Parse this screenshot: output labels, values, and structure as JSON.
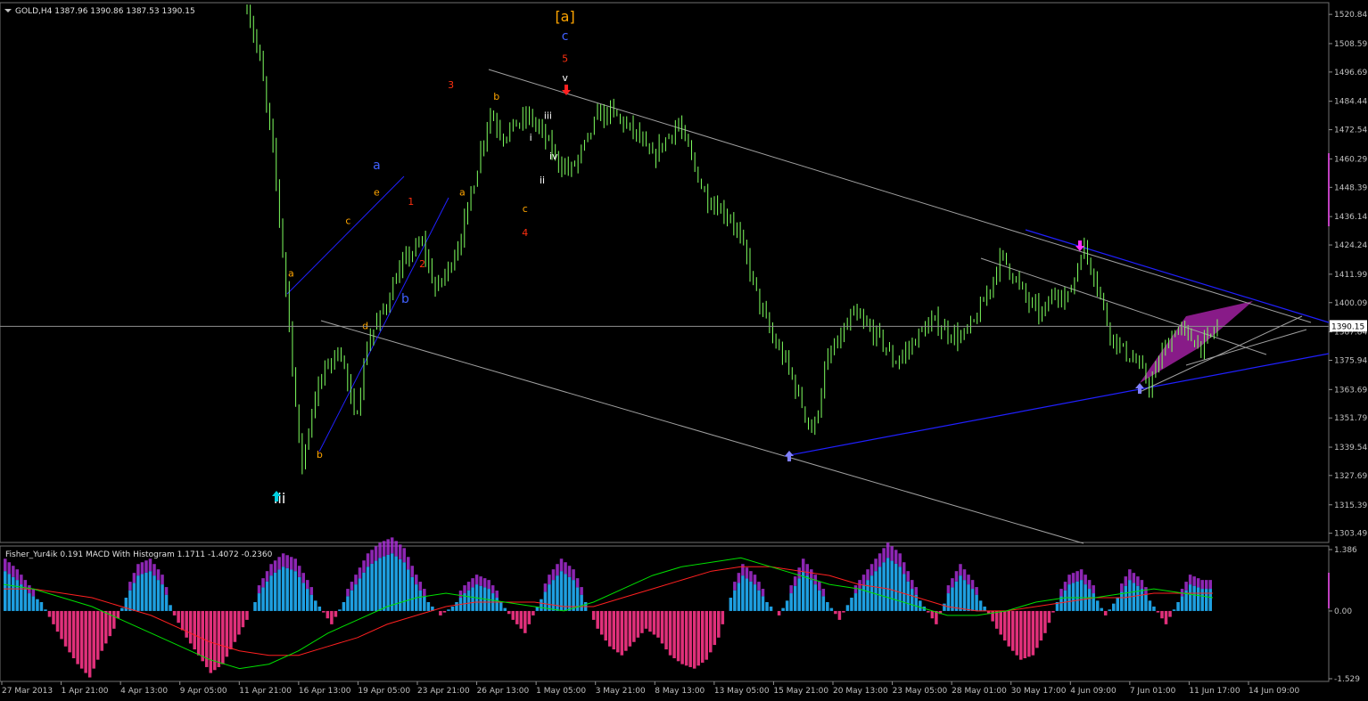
{
  "header": {
    "symbol_info": "GOLD,H4  1387.96 1390.86 1387.53 1390.15"
  },
  "indicator_header": {
    "label": "Fisher_Yur4ik 0.191  MACD With Histogram 1.1711 -1.4072 -0.2360"
  },
  "colors": {
    "background": "#000000",
    "candle": "#7fff5f",
    "axis_text": "#c0c0c0",
    "trendline_blue": "#2020ff",
    "trendline_gray": "#a0a0a0",
    "pattern_fill": "#a020a0",
    "hist_pos": "#1e9fe0",
    "hist_neg": "#e0307a",
    "fisher_pos": "#b030e0",
    "macd_green": "#00e000",
    "signal_red": "#ff2020"
  },
  "chart_data": [
    {
      "type": "candlestick",
      "symbol": "GOLD",
      "timeframe": "H4",
      "title": "GOLD,H4",
      "ohlc_last": {
        "open": 1387.96,
        "high": 1390.86,
        "low": 1387.53,
        "close": 1390.15
      },
      "current_price": "1390.15",
      "ylim": [
        1300.0,
        1525.0
      ],
      "y_ticks": [
        "1520.84",
        "1508.59",
        "1496.69",
        "1484.44",
        "1472.54",
        "1460.29",
        "1448.39",
        "1436.14",
        "1424.24",
        "1411.99",
        "1400.09",
        "1387.84",
        "1375.94",
        "1363.69",
        "1351.79",
        "1339.54",
        "1327.69",
        "1315.39",
        "1303.49"
      ],
      "x_ticks": [
        "27 Mar 2013",
        "1 Apr 21:00",
        "4 Apr 13:00",
        "9 Apr 05:00",
        "11 Apr 21:00",
        "16 Apr 13:00",
        "19 Apr 05:00",
        "23 Apr 21:00",
        "26 Apr 13:00",
        "1 May 05:00",
        "3 May 21:00",
        "8 May 13:00",
        "13 May 05:00",
        "15 May 21:00",
        "20 May 13:00",
        "23 May 05:00",
        "28 May 01:00",
        "30 May 17:00",
        "4 Jun 09:00",
        "7 Jun 01:00",
        "11 Jun 17:00",
        "14 Jun 09:00"
      ],
      "close_path": [
        1525,
        1500,
        1460,
        1400,
        1330,
        1360,
        1375,
        1380,
        1350,
        1385,
        1395,
        1410,
        1420,
        1425,
        1405,
        1415,
        1430,
        1455,
        1480,
        1470,
        1475,
        1478,
        1470,
        1460,
        1455,
        1465,
        1478,
        1480,
        1475,
        1470,
        1460,
        1468,
        1475,
        1460,
        1445,
        1440,
        1435,
        1420,
        1400,
        1385,
        1375,
        1360,
        1345,
        1375,
        1385,
        1395,
        1390,
        1385,
        1375,
        1380,
        1388,
        1392,
        1388,
        1385,
        1392,
        1405,
        1420,
        1410,
        1400,
        1395,
        1405,
        1402,
        1424,
        1410,
        1388,
        1380,
        1375,
        1365,
        1380,
        1390,
        1385,
        1382,
        1390
      ],
      "wave_labels": [
        {
          "text": "[a]",
          "color": "#ffa500",
          "x": 99,
          "y": 1518
        },
        {
          "text": "c",
          "color": "#4060ff",
          "x": 99,
          "y": 1510
        },
        {
          "text": "5",
          "color": "#ff3010",
          "x": 99,
          "y": 1501
        },
        {
          "text": "v",
          "color": "#ffffff",
          "x": 99,
          "y": 1493
        },
        {
          "text": "3",
          "color": "#ff3010",
          "x": 79,
          "y": 1490
        },
        {
          "text": "b",
          "color": "#ffa500",
          "x": 87,
          "y": 1485
        },
        {
          "text": "iii",
          "color": "#ffffff",
          "x": 96,
          "y": 1477
        },
        {
          "text": "i",
          "color": "#ffffff",
          "x": 93,
          "y": 1468
        },
        {
          "text": "iv",
          "color": "#ffffff",
          "x": 97,
          "y": 1460
        },
        {
          "text": "ii",
          "color": "#ffffff",
          "x": 95,
          "y": 1450
        },
        {
          "text": "a",
          "color": "#ffa500",
          "x": 81,
          "y": 1445
        },
        {
          "text": "c",
          "color": "#ffa500",
          "x": 92,
          "y": 1438
        },
        {
          "text": "4",
          "color": "#ff3010",
          "x": 92,
          "y": 1428
        },
        {
          "text": "a",
          "color": "#4060ff",
          "x": 66,
          "y": 1456
        },
        {
          "text": "e",
          "color": "#ffa500",
          "x": 66,
          "y": 1445
        },
        {
          "text": "1",
          "color": "#ff3010",
          "x": 72,
          "y": 1441
        },
        {
          "text": "c",
          "color": "#ffa500",
          "x": 61,
          "y": 1433
        },
        {
          "text": "2",
          "color": "#ff3010",
          "x": 74,
          "y": 1415
        },
        {
          "text": "a",
          "color": "#ffa500",
          "x": 51,
          "y": 1411
        },
        {
          "text": "b",
          "color": "#4060ff",
          "x": 71,
          "y": 1400
        },
        {
          "text": "d",
          "color": "#ffa500",
          "x": 64,
          "y": 1389
        },
        {
          "text": "b",
          "color": "#ffa500",
          "x": 56,
          "y": 1335
        },
        {
          "text": "iii",
          "color": "#ffffff",
          "x": 49,
          "y": 1316
        }
      ]
    },
    {
      "type": "bar",
      "name_fisher": "Fisher_Yur4ik",
      "value_fisher": 0.191,
      "name_macd": "MACD With Histogram",
      "macd_values": [
        1.1711,
        -1.4072,
        -0.236
      ],
      "ylim": [
        -1.529,
        1.386
      ],
      "y_ticks": [
        "1.386",
        "0.00",
        "-1.529"
      ],
      "histogram": [
        0.9,
        0.7,
        0.4,
        0.2,
        -0.3,
        -0.8,
        -1.2,
        -1.5,
        -0.9,
        -0.4,
        0.3,
        0.8,
        0.9,
        0.6,
        -0.1,
        -0.6,
        -1.0,
        -1.4,
        -1.2,
        -0.7,
        -0.2,
        0.4,
        0.8,
        1.0,
        0.9,
        0.5,
        0.1,
        -0.3,
        0.2,
        0.6,
        1.0,
        1.2,
        1.3,
        1.1,
        0.6,
        0.2,
        -0.1,
        0.1,
        0.4,
        0.6,
        0.5,
        0.2,
        -0.2,
        -0.5,
        0.1,
        0.6,
        0.9,
        0.7,
        0.2,
        -0.4,
        -0.8,
        -1.0,
        -0.7,
        -0.4,
        -0.6,
        -1.0,
        -1.2,
        -1.3,
        -1.1,
        -0.6,
        0.3,
        0.8,
        0.6,
        0.2,
        -0.1,
        0.4,
        0.9,
        0.6,
        0.2,
        -0.2,
        0.3,
        0.6,
        0.9,
        1.2,
        1.0,
        0.5,
        0.1,
        -0.3,
        0.4,
        0.8,
        0.5,
        0.1,
        -0.4,
        -0.8,
        -1.1,
        -1.0,
        -0.5,
        0.2,
        0.6,
        0.7,
        0.4,
        -0.1,
        0.3,
        0.7,
        0.5,
        0.1,
        -0.3,
        0.2,
        0.6,
        0.5
      ],
      "macd_line": [
        0.6,
        0.5,
        0.3,
        0.1,
        -0.2,
        -0.5,
        -0.8,
        -1.1,
        -1.3,
        -1.2,
        -0.9,
        -0.5,
        -0.2,
        0.1,
        0.3,
        0.4,
        0.3,
        0.2,
        0.1,
        0.0,
        0.2,
        0.5,
        0.8,
        1.0,
        1.1,
        1.2,
        1.0,
        0.8,
        0.6,
        0.5,
        0.3,
        0.1,
        -0.1,
        -0.1,
        0.0,
        0.2,
        0.3,
        0.3,
        0.4,
        0.5,
        0.4,
        0.3
      ],
      "signal_line": [
        0.5,
        0.5,
        0.4,
        0.3,
        0.1,
        -0.1,
        -0.4,
        -0.7,
        -0.9,
        -1.0,
        -1.0,
        -0.8,
        -0.6,
        -0.3,
        -0.1,
        0.1,
        0.2,
        0.2,
        0.2,
        0.1,
        0.1,
        0.3,
        0.5,
        0.7,
        0.9,
        1.0,
        1.0,
        0.9,
        0.8,
        0.6,
        0.5,
        0.3,
        0.1,
        0.0,
        0.0,
        0.1,
        0.2,
        0.3,
        0.3,
        0.4,
        0.4,
        0.4
      ]
    }
  ]
}
